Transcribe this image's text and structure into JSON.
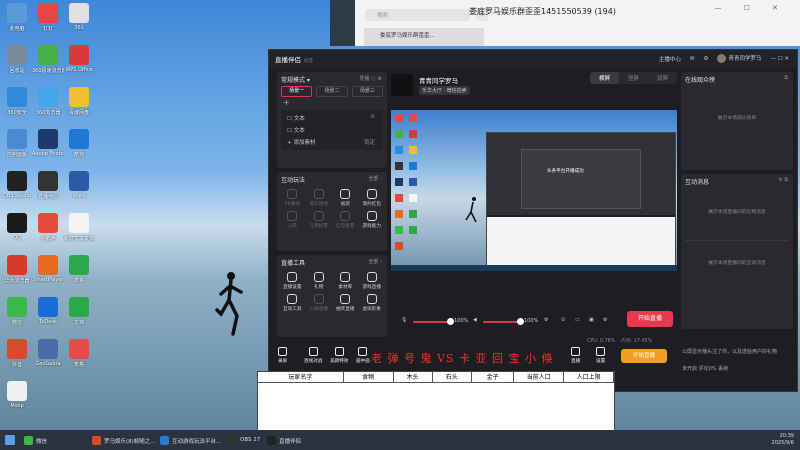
{
  "desktop": {
    "icons": [
      {
        "label": "此电脑",
        "color": "#5a9ad8"
      },
      {
        "label": "钉钉",
        "color": "#e84545"
      },
      {
        "label": "360",
        "color": "#e0e0e0"
      },
      {
        "label": "回收站",
        "color": "#7a8a9a"
      },
      {
        "label": "360极速浏览器",
        "color": "#46b04a"
      },
      {
        "label": "WPS Office",
        "color": "#d83a3a"
      },
      {
        "label": "360安全",
        "color": "#2e8bd8"
      },
      {
        "label": "360浏览器",
        "color": "#45a6e8"
      },
      {
        "label": "百度网盘",
        "color": "#f0c030"
      },
      {
        "label": "控制面板",
        "color": "#4a8ad0"
      },
      {
        "label": "Adobe Photoshop",
        "color": "#1e3a6a"
      },
      {
        "label": "酷狗",
        "color": "#1e78d8"
      },
      {
        "label": "OBS Studio",
        "color": "#222"
      },
      {
        "label": "直播伴侣",
        "color": "#333"
      },
      {
        "label": "Word",
        "color": "#2a5aa8"
      },
      {
        "label": "QQ",
        "color": "#1a1a1a"
      },
      {
        "label": "小鹅通",
        "color": "#e84a3a"
      },
      {
        "label": "新建文本文档",
        "color": "#f4f4f4"
      },
      {
        "label": "华为浏览器",
        "color": "#d83a2a"
      },
      {
        "label": "SmartPlayer",
        "color": "#e86a20"
      },
      {
        "label": "表格",
        "color": "#2aa84a"
      },
      {
        "label": "微信",
        "color": "#3ab84a"
      },
      {
        "label": "ToDesk",
        "color": "#1a6ad8"
      },
      {
        "label": "文档",
        "color": "#2aa84a"
      },
      {
        "label": "抖音",
        "color": "#d84a2a"
      },
      {
        "label": "GeoGebra",
        "color": "#4a6aa8"
      },
      {
        "label": "表格",
        "color": "#e84a4a"
      },
      {
        "label": "Msbp",
        "color": "#f0f0f0"
      }
    ]
  },
  "qq": {
    "search_placeholder": "搜索",
    "plus": "+",
    "chat_item": "娄底罗马娱乐群歪歪...",
    "chat_title": "娄底罗马娱乐群歪歪1451550539 (194)",
    "controls": "— ☐ ✕"
  },
  "app": {
    "title": "直播伴侣",
    "beta": "抖音",
    "topbar": {
      "user_center": "主播中心",
      "username": "青青同学罗马",
      "controls": "— ☐ ✕"
    },
    "scenes": {
      "mode_label": "常规模式",
      "import_label": "导播",
      "tabs": [
        "场景一",
        "场景二",
        "场景三"
      ],
      "add": "+",
      "sources": [
        {
          "label": "文本",
          "right": ""
        },
        {
          "label": "文本",
          "right": ""
        }
      ],
      "add_source": "添加素材",
      "lock": "锁定"
    },
    "interact": {
      "header": "互动玩法",
      "more": "全部",
      "tools": [
        {
          "label": "PK连线",
          "dim": true
        },
        {
          "label": "观众连线",
          "dim": true
        },
        {
          "label": "福袋",
          "dim": false
        },
        {
          "label": "简约红包",
          "dim": false
        },
        {
          "label": "心愿",
          "dim": true
        },
        {
          "label": "礼物投票",
          "dim": true
        },
        {
          "label": "红包投票",
          "dim": true
        },
        {
          "label": "游戏能力",
          "dim": false
        }
      ]
    },
    "live_tools": {
      "header": "直播工具",
      "more": "全部",
      "tools": [
        {
          "label": "直播设置",
          "dim": false
        },
        {
          "label": "礼物",
          "dim": false
        },
        {
          "label": "素材库",
          "dim": false
        },
        {
          "label": "游戏直播",
          "dim": false
        },
        {
          "label": "互动工具",
          "dim": false
        },
        {
          "label": "心愿直播",
          "dim": true
        },
        {
          "label": "抽奖直播",
          "dim": false
        },
        {
          "label": "虚拟形象",
          "dim": false
        }
      ]
    },
    "anchor": {
      "name": "青青同学罗马",
      "tag": "乐华大厅 · 微信拍卖"
    },
    "mode_tabs": [
      "横屏",
      "竖屏",
      "双屏"
    ],
    "preview_toast": "头条平台开播成功",
    "audio": {
      "mic_pct": "100%",
      "speaker_pct": "100%"
    },
    "start_btn": "开始直播",
    "status": [
      "CPU: 0.78%",
      "内存: 17.45%",
      "帧率: 0%",
      "丢帧"
    ],
    "right": {
      "viewers_header": "在线观众榜",
      "viewers_empty": "展示本场观众榜单",
      "messages_header": "互动消息",
      "messages_empty_1": "展示本场直播间的礼物消息",
      "messages_empty_2": "展示本场直播间的互动消息",
      "bottom_note": "公屏显示播头注了你，以及送给用户的礼物",
      "bottom_stats": [
        "未开启",
        "评论0%",
        "丢帧"
      ]
    }
  },
  "overlay": {
    "tools": [
      "录屏",
      "连线对战",
      "美颜特效",
      "画中画",
      "直播间",
      "",
      "",
      "",
      "",
      "",
      "",
      "直播",
      "设置"
    ],
    "vs_left": "老 弹 号 鬼 VS 卡 亚 回 宝 小 倏",
    "start": "开始直播"
  },
  "score_table": {
    "headers": [
      "玩家名字",
      "食物",
      "木头",
      "石头",
      "金子",
      "当前人口",
      "人口上限"
    ]
  },
  "taskbar": {
    "items": [
      {
        "label": "微信",
        "color": "#3ab84a"
      },
      {
        "label": "罗马娱乐(8)帧随之...",
        "color": "#d84a2a"
      },
      {
        "label": "互动游戏玩法平台...",
        "color": "#2a7ad8"
      },
      {
        "label": "OBS 27",
        "color": "#333"
      },
      {
        "label": "直播伴侣",
        "color": "#222"
      }
    ],
    "time": "20:39",
    "date": "2025/9/6"
  }
}
